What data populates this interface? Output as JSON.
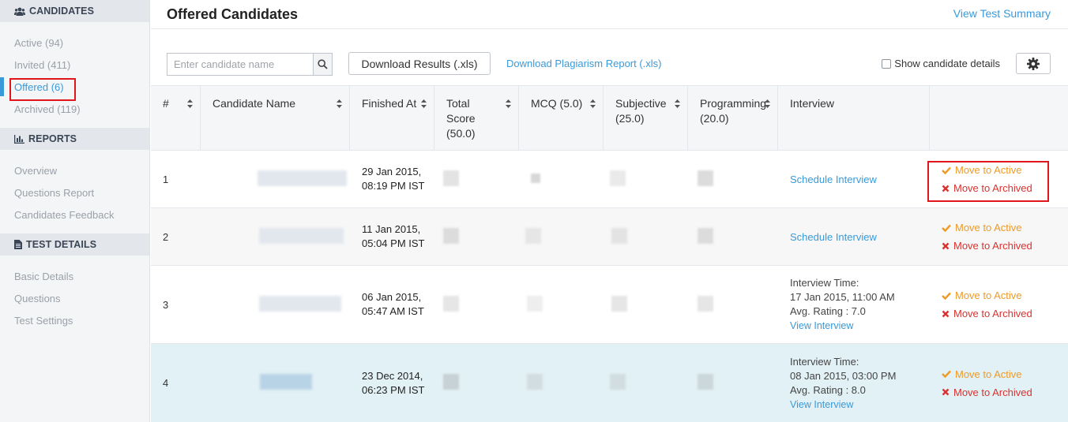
{
  "sidebar": {
    "candidates_header": "CANDIDATES",
    "candidates_items": [
      {
        "label": "Active (94)"
      },
      {
        "label": "Invited (411)"
      },
      {
        "label": "Offered (6)"
      },
      {
        "label": "Archived (119)"
      }
    ],
    "reports_header": "REPORTS",
    "reports_items": [
      {
        "label": "Overview"
      },
      {
        "label": "Questions Report"
      },
      {
        "label": "Candidates Feedback"
      }
    ],
    "test_header": "TEST DETAILS",
    "test_items": [
      {
        "label": "Basic Details"
      },
      {
        "label": "Questions"
      },
      {
        "label": "Test Settings"
      }
    ]
  },
  "main": {
    "title": "Offered Candidates",
    "view_summary": "View Test Summary"
  },
  "toolbar": {
    "search_placeholder": "Enter candidate name",
    "download_results": "Download Results (.xls)",
    "download_plagiarism": "Download Plagiarism Report (.xls)",
    "show_details": "Show candidate details"
  },
  "table": {
    "columns": [
      "#",
      "Candidate Name",
      "Finished At",
      "Total Score (50.0)",
      "MCQ (5.0)",
      "Subjective (25.0)",
      "Programming (20.0)",
      "Interview",
      ""
    ],
    "rows": [
      {
        "num": "1",
        "finished_date": "29 Jan 2015,",
        "finished_time": "08:19 PM IST",
        "interview_link": "Schedule Interview",
        "move_active": "Move to Active",
        "move_archived": "Move to Archived"
      },
      {
        "num": "2",
        "finished_date": "11 Jan 2015,",
        "finished_time": "05:04 PM IST",
        "interview_link": "Schedule Interview",
        "move_active": "Move to Active",
        "move_archived": "Move to Archived"
      },
      {
        "num": "3",
        "finished_date": "06 Jan 2015,",
        "finished_time": "05:47 AM IST",
        "interview_time_label": "Interview Time:",
        "interview_time": "17 Jan 2015, 11:00 AM",
        "avg_rating": "Avg. Rating : 7.0",
        "interview_link": "View Interview",
        "move_active": "Move to Active",
        "move_archived": "Move to Archived"
      },
      {
        "num": "4",
        "finished_date": "23 Dec 2014,",
        "finished_time": "06:23 PM IST",
        "interview_time_label": "Interview Time:",
        "interview_time": "08 Jan 2015, 03:00 PM",
        "avg_rating": "Avg. Rating : 8.0",
        "interview_link": "View Interview",
        "move_active": "Move to Active",
        "move_archived": "Move to Archived"
      }
    ]
  },
  "colors": {
    "accent": "#3a9ad9",
    "move_active": "#ee9a25",
    "move_archived": "#d9322f",
    "highlight": "#e0161b"
  }
}
